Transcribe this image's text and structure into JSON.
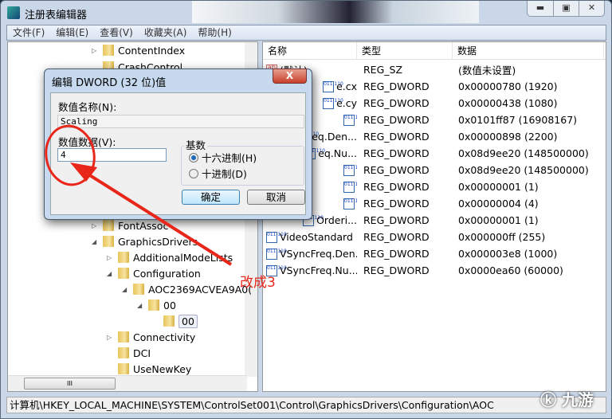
{
  "window": {
    "title": "注册表编辑器",
    "controls": [
      "minimize",
      "maximize",
      "close"
    ]
  },
  "menu": [
    "文件(F)",
    "编辑(E)",
    "查看(V)",
    "收藏夹(A)",
    "帮助(H)"
  ],
  "tree": [
    {
      "label": "ContentIndex",
      "level": 0,
      "expander": "collapsed"
    },
    {
      "label": "CrashControl",
      "level": 0,
      "expander": "none"
    },
    {
      "label": "FontAssoc",
      "level": 0,
      "expander": "collapsed"
    },
    {
      "label": "GraphicsDrivers",
      "level": 0,
      "expander": "expanded"
    },
    {
      "label": "AdditionalModeLists",
      "level": 1,
      "expander": "collapsed"
    },
    {
      "label": "Configuration",
      "level": 1,
      "expander": "expanded"
    },
    {
      "label": "AOC2369ACVEA9A0(",
      "level": 2,
      "expander": "expanded"
    },
    {
      "label": "00",
      "level": 3,
      "expander": "expanded"
    },
    {
      "label": "00",
      "level": 4,
      "expander": "none",
      "selected": true
    },
    {
      "label": "Connectivity",
      "level": 1,
      "expander": "collapsed"
    },
    {
      "label": "DCI",
      "level": 1,
      "expander": "none"
    },
    {
      "label": "UseNewKey",
      "level": 1,
      "expander": "none"
    }
  ],
  "list": {
    "headers": [
      "名称",
      "类型",
      "数据"
    ],
    "rows": [
      {
        "name": "(默认)",
        "type": "REG_SZ",
        "data": "(数值未设置)",
        "icon": "string"
      },
      {
        "name": "e.cx",
        "type": "REG_DWORD",
        "data": "0x00000780 (1920)",
        "icon": "binary"
      },
      {
        "name": "e.cy",
        "type": "REG_DWORD",
        "data": "0x00000438 (1080)",
        "icon": "binary"
      },
      {
        "name": "",
        "type": "REG_DWORD",
        "data": "0x0101ff87 (16908167)",
        "icon": "binary"
      },
      {
        "name": "eq.Den...",
        "type": "REG_DWORD",
        "data": "0x00000898 (2200)",
        "icon": "binary"
      },
      {
        "name": "eq.Nu...",
        "type": "REG_DWORD",
        "data": "0x08d9ee20 (148500000)",
        "icon": "binary"
      },
      {
        "name": "",
        "type": "REG_DWORD",
        "data": "0x08d9ee20 (148500000)",
        "icon": "binary"
      },
      {
        "name": "",
        "type": "REG_DWORD",
        "data": "0x00000001 (1)",
        "icon": "binary"
      },
      {
        "name": "",
        "type": "REG_DWORD",
        "data": "0x00000004 (4)",
        "icon": "binary"
      },
      {
        "name": "Orderi...",
        "type": "REG_DWORD",
        "data": "0x00000001 (1)",
        "icon": "binary"
      },
      {
        "name": "VideoStandard",
        "type": "REG_DWORD",
        "data": "0x000000ff (255)",
        "icon": "binary"
      },
      {
        "name": "VSyncFreq.Den...",
        "type": "REG_DWORD",
        "data": "0x000003e8 (1000)",
        "icon": "binary"
      },
      {
        "name": "VSyncFreq.Nu...",
        "type": "REG_DWORD",
        "data": "0x0000ea60 (60000)",
        "icon": "binary"
      }
    ]
  },
  "status_path": "计算机\\HKEY_LOCAL_MACHINE\\SYSTEM\\ControlSet001\\Control\\GraphicsDrivers\\Configuration\\AOC",
  "dialog": {
    "title": "编辑 DWORD (32 位)值",
    "name_label": "数值名称(N):",
    "name_value": "Scaling",
    "data_label": "数值数据(V):",
    "data_value": "4",
    "base_label": "基数",
    "radio_hex": "十六进制(H)",
    "radio_dec": "十进制(D)",
    "selected_base": "hex",
    "ok": "确定",
    "cancel": "取消",
    "close": "X"
  },
  "annotation": {
    "text": "改成3",
    "color": "#e8261a"
  },
  "watermark": "九游"
}
